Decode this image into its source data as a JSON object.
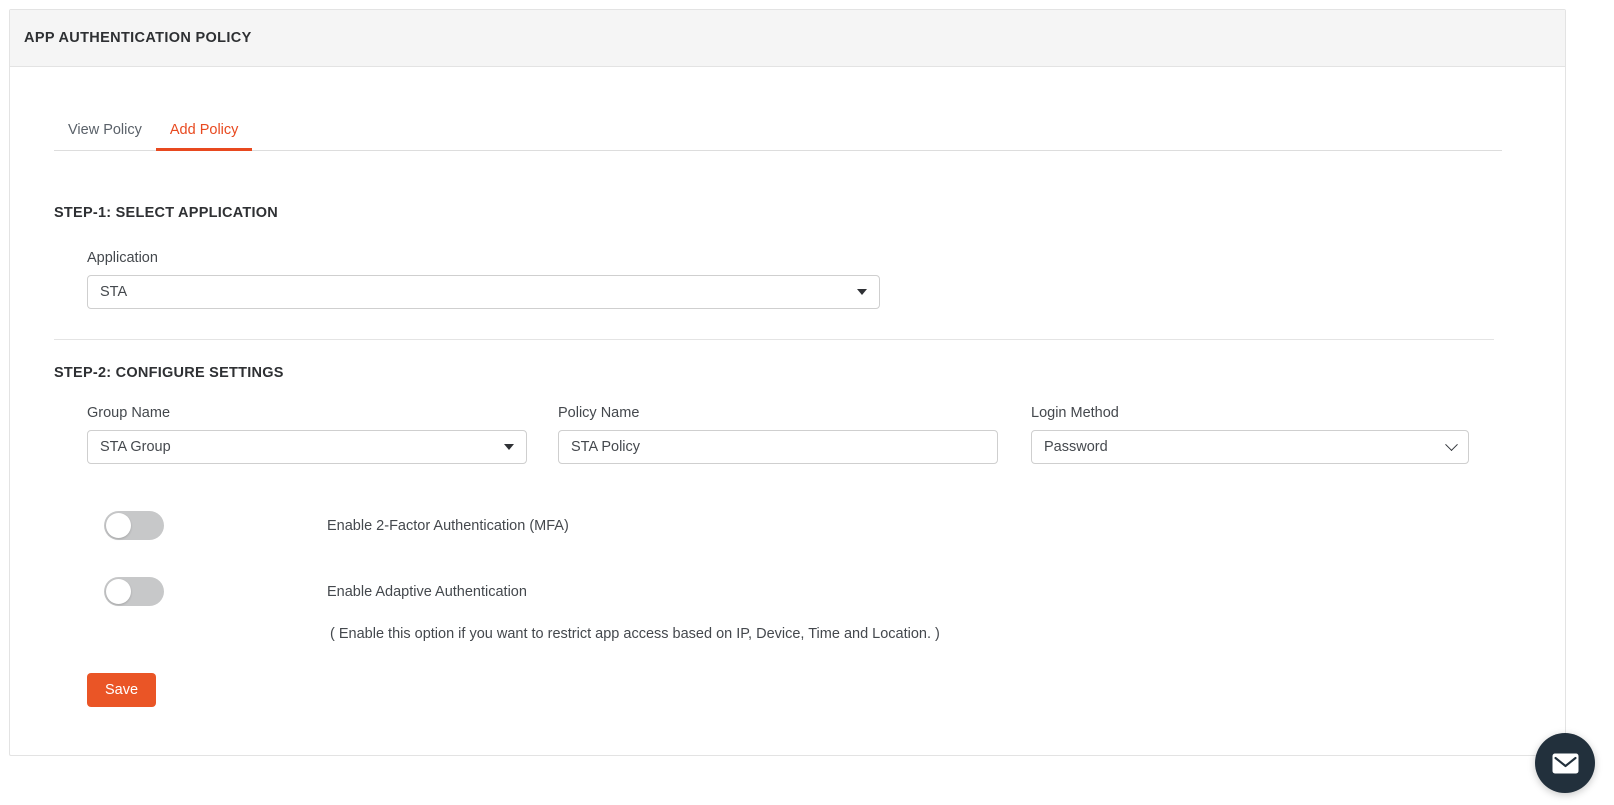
{
  "header": {
    "title": "APP AUTHENTICATION POLICY"
  },
  "tabs": [
    {
      "label": "View Policy",
      "active": false
    },
    {
      "label": "Add Policy",
      "active": true
    }
  ],
  "step1": {
    "title": "STEP-1: SELECT APPLICATION",
    "application": {
      "label": "Application",
      "value": "STA",
      "icon": "caret-down-icon"
    }
  },
  "step2": {
    "title": "STEP-2: CONFIGURE SETTINGS",
    "group_name": {
      "label": "Group Name",
      "value": "STA Group",
      "icon": "caret-down-icon"
    },
    "policy_name": {
      "label": "Policy Name",
      "value": "STA Policy",
      "placeholder": "Policy Name"
    },
    "login_method": {
      "label": "Login Method",
      "value": "Password",
      "icon": "chevron-down-icon"
    },
    "toggles": [
      {
        "label": "Enable 2-Factor Authentication (MFA)",
        "enabled": false
      },
      {
        "label": "Enable Adaptive Authentication",
        "enabled": false
      }
    ],
    "adaptive_hint": "( Enable this option if you want to restrict app access based on IP, Device, Time and Location. )",
    "save_label": "Save"
  },
  "chat": {
    "icon": "envelope-icon"
  },
  "colors": {
    "accent": "#e8491f",
    "save_button": "#ea5526",
    "header_bg": "#f5f5f5",
    "chat_bg": "#22303c",
    "toggle_off": "#c7c8c9"
  }
}
